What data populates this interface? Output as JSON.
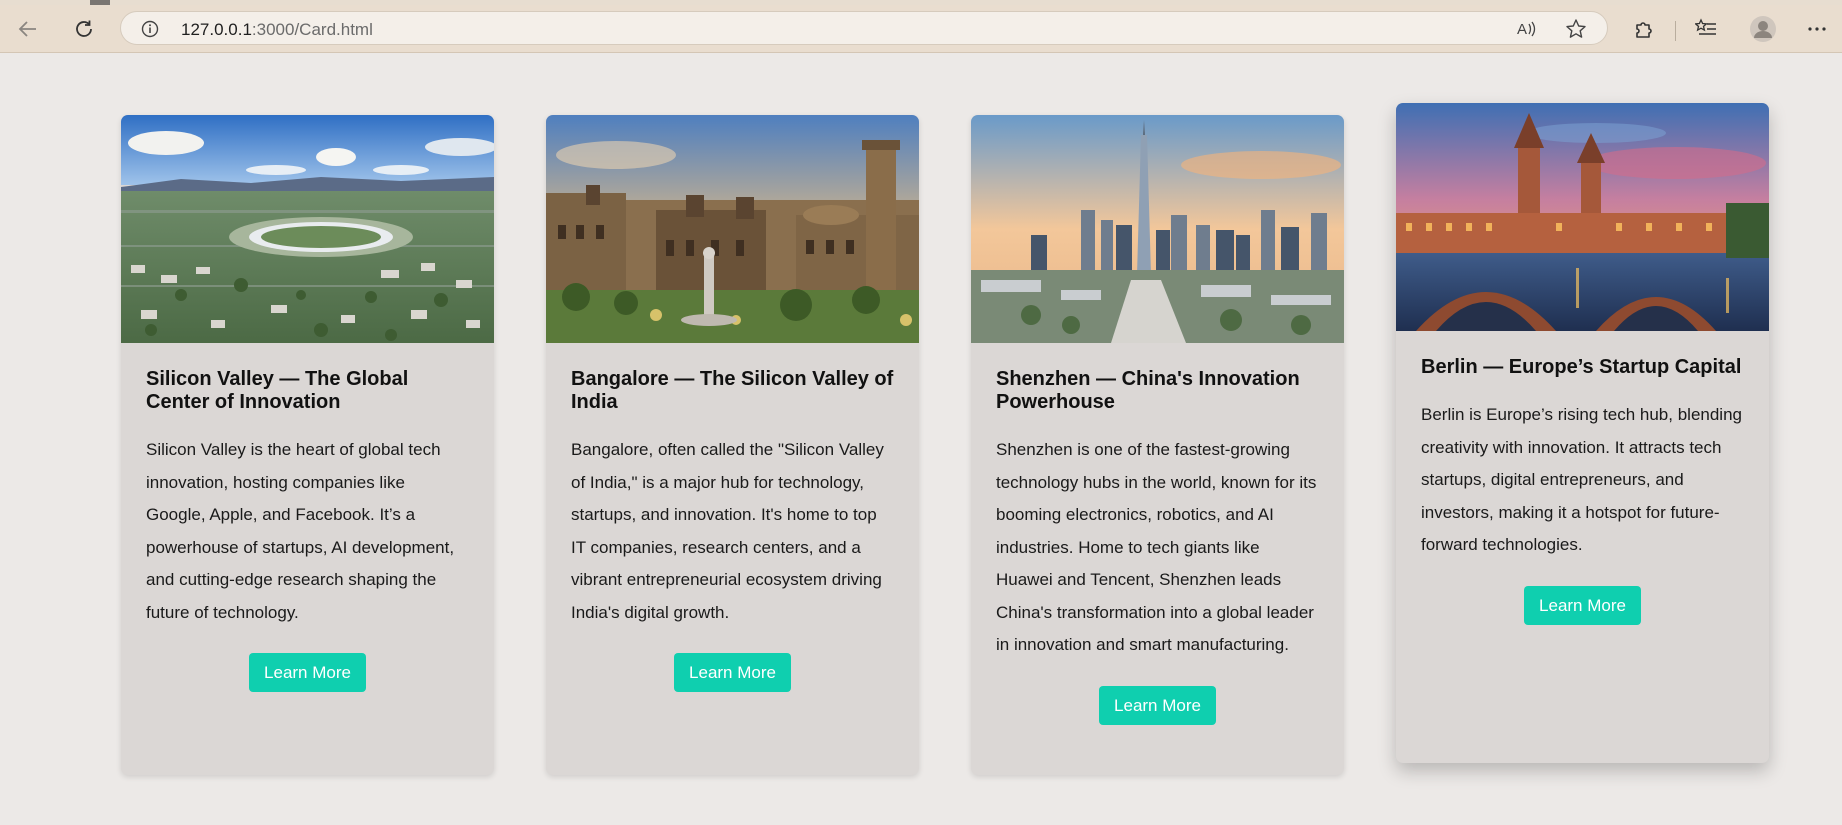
{
  "browser": {
    "url_host": "127.0.0.1",
    "url_rest": ":3000/Card.html",
    "back_icon": "back-arrow-icon",
    "reload_icon": "reload-icon",
    "info_icon": "info-icon",
    "read_aloud_icon": "read-aloud-icon",
    "favorite_icon": "star-icon",
    "extensions_icon": "puzzle-icon",
    "collections_icon": "favorites-list-icon",
    "profile_icon": "avatar-icon",
    "menu_icon": "more-icon"
  },
  "accent_color": "#0fcfaf",
  "cards": [
    {
      "title": "Silicon Valley — The Global Center of Innovation",
      "body": "Silicon Valley is the heart of global tech innovation, hosting companies like Google, Apple, and Facebook. It’s a powerhouse of startups, AI development, and cutting-edge research shaping the future of technology.",
      "button": "Learn More",
      "image": "Aerial view of a ring-shaped campus among suburbs under blue sky"
    },
    {
      "title": "Bangalore — The Silicon Valley of India",
      "body": "Bangalore, often called the \"Silicon Valley of India,\" is a major hub for technology, startups, and innovation. It's home to top IT companies, research centers, and a vibrant entrepreneurial ecosystem driving India's digital growth.",
      "button": "Learn More",
      "image": "Stone palace with towers and gardens at sunset"
    },
    {
      "title": "Shenzhen — China's Innovation Powerhouse",
      "body": "Shenzhen is one of the fastest-growing technology hubs in the world, known for its booming electronics, robotics, and AI industries. Home to tech giants like Huawei and Tencent, Shenzhen leads China's transformation into a global leader in innovation and smart manufacturing.",
      "button": "Learn More",
      "image": "City skyline with tall skyscraper at sunset"
    },
    {
      "title": "Berlin — Europe’s Startup Capital",
      "body": "Berlin is Europe’s rising tech hub, blending creativity with innovation. It attracts tech startups, digital entrepreneurs, and investors, making it a hotspot for future-forward technologies.",
      "button": "Learn More",
      "image": "Brick bridge with towers over river at dusk"
    }
  ]
}
